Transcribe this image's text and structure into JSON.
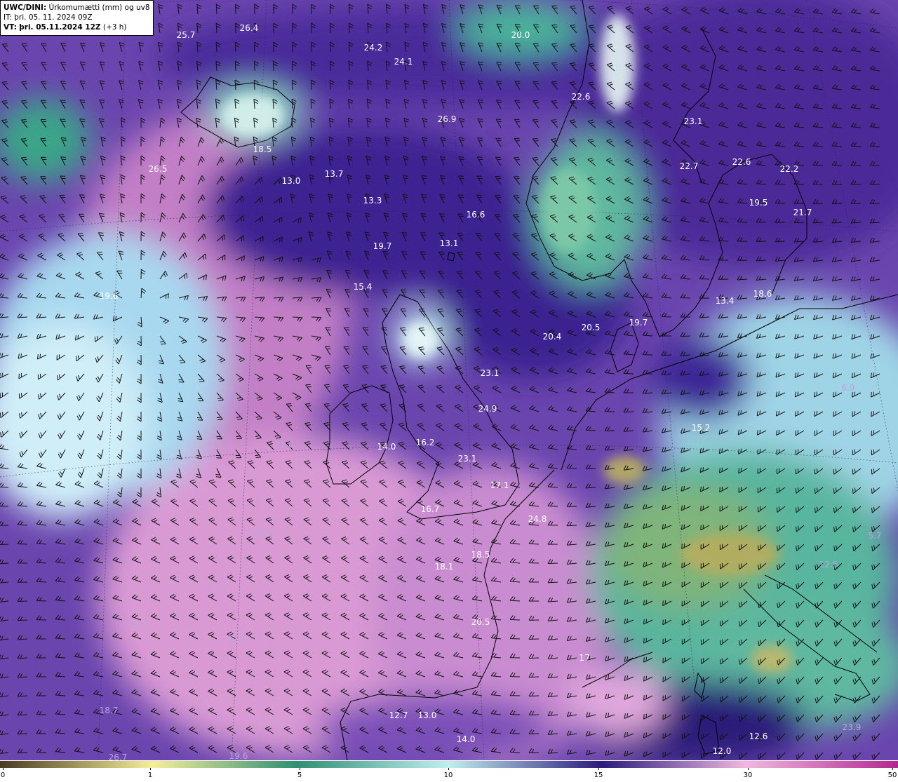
{
  "header": {
    "model": "UWC/DINI:",
    "field": "Úrkomumætti (mm) og uv850.",
    "it_label": "IT:",
    "it_value": "þri. 05. 11. 2024 09Z",
    "vt_label": "VT:",
    "vt_value": "þri. 05.11.2024 12Z",
    "vt_lead": "(+3 h)"
  },
  "colors": {
    "ocean_base": "#7d56b8",
    "land_line": "#000000",
    "label_dark": "#ffffff",
    "label_light": "#b9a6d9"
  },
  "colorbar": {
    "ticks": [
      "0",
      "1",
      "5",
      "10",
      "15",
      "30",
      "50"
    ],
    "stops": [
      "#4a3a1f",
      "#f5ef9a",
      "#2f8f72",
      "#bfeff0",
      "#2a1a7a",
      "#f0b8e0",
      "#b2288f"
    ]
  },
  "value_labels": [
    {
      "text": "25.7"
    },
    {
      "text": "26.4"
    },
    {
      "text": "24.2"
    },
    {
      "text": "24.1"
    },
    {
      "text": "20.0"
    },
    {
      "text": "22.6"
    },
    {
      "text": "23.1"
    },
    {
      "text": "22.7"
    },
    {
      "text": "22.6"
    },
    {
      "text": "22.2"
    },
    {
      "text": "19.5"
    },
    {
      "text": "21.7"
    },
    {
      "text": "26.9"
    },
    {
      "text": "18.5"
    },
    {
      "text": "26.5"
    },
    {
      "text": "13.0"
    },
    {
      "text": "13.7"
    },
    {
      "text": "13.3"
    },
    {
      "text": "16.6"
    },
    {
      "text": "19.7"
    },
    {
      "text": "13.1"
    },
    {
      "text": "15.4"
    },
    {
      "text": "19.6"
    },
    {
      "text": "20.4"
    },
    {
      "text": "20.5"
    },
    {
      "text": "19.7"
    },
    {
      "text": "13.4"
    },
    {
      "text": "18.6"
    },
    {
      "text": "23.1"
    },
    {
      "text": "24.9"
    },
    {
      "text": "6.9"
    },
    {
      "text": "15.2"
    },
    {
      "text": "14.0"
    },
    {
      "text": "16.2"
    },
    {
      "text": "21.6"
    },
    {
      "text": "23.1"
    },
    {
      "text": "17.1"
    },
    {
      "text": "16.7"
    },
    {
      "text": "24.8"
    },
    {
      "text": "20.5"
    },
    {
      "text": "18.5"
    },
    {
      "text": "18.1"
    },
    {
      "text": "22.9"
    },
    {
      "text": "23.5"
    },
    {
      "text": "22.9"
    },
    {
      "text": "20.5"
    },
    {
      "text": "5.7"
    },
    {
      "text": "12.5"
    },
    {
      "text": "18.7"
    },
    {
      "text": "12.7"
    },
    {
      "text": "13.0"
    },
    {
      "text": "14.0"
    },
    {
      "text": "12.6"
    },
    {
      "text": "23.9"
    },
    {
      "text": "12.0"
    },
    {
      "text": "19.6"
    },
    {
      "text": "26.7"
    },
    {
      "text": "17"
    }
  ]
}
